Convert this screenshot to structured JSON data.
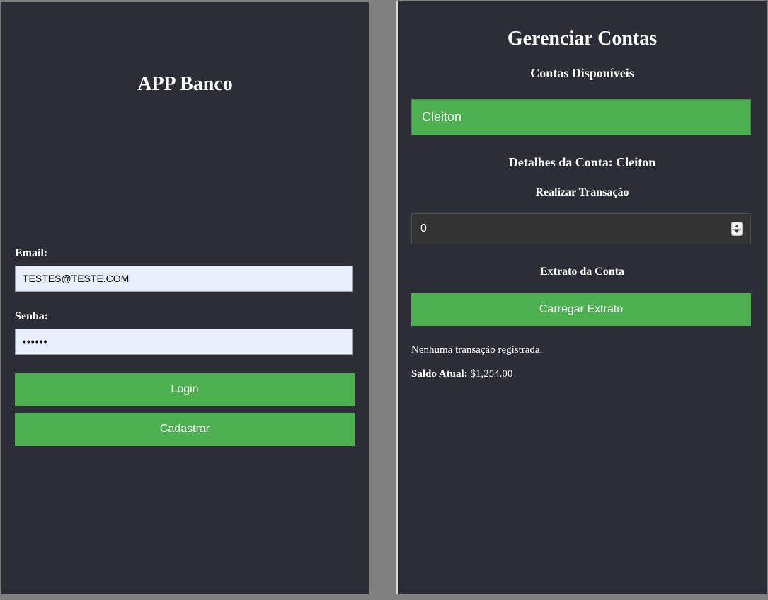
{
  "login": {
    "title": "APP Banco",
    "email_label": "Email:",
    "email_value": "TESTES@TESTE.COM",
    "password_label": "Senha:",
    "password_value": "••••••",
    "login_button": "Login",
    "signup_button": "Cadastrar"
  },
  "manage": {
    "title": "Gerenciar Contas",
    "accounts_heading": "Contas Disponíveis",
    "accounts": [
      "Cleiton"
    ],
    "details_heading": "Detalhes da Conta: Cleiton",
    "transaction_heading": "Realizar Transação",
    "amount_value": "0",
    "statement_heading": "Extrato da Conta",
    "load_statement_button": "Carregar Extrato",
    "no_transactions": "Nenhuma transação registrada.",
    "balance_label": "Saldo Atual:",
    "balance_value": "$1,254.00"
  },
  "colors": {
    "panel_bg": "#2b2e36",
    "accent_green": "#4caf50",
    "input_autofill": "#e8f0fe"
  }
}
